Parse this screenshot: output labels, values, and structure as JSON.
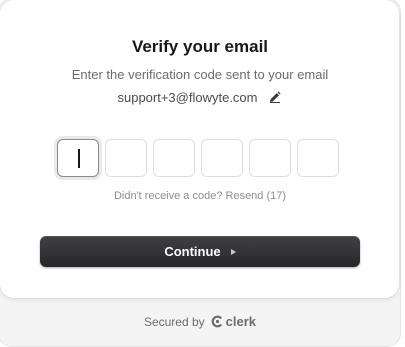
{
  "header": {
    "title": "Verify your email",
    "subtitle": "Enter the verification code sent to your email",
    "email": "support+3@flowyte.com",
    "edit_icon": "pencil-icon"
  },
  "otp": {
    "digits": [
      "",
      "",
      "",
      "",
      "",
      ""
    ],
    "active_index": 0
  },
  "resend": {
    "text": "Didn't receive a code? Resend (17)"
  },
  "actions": {
    "continue_label": "Continue",
    "continue_icon": "play-triangle-icon",
    "button_color": "#2f2f33"
  },
  "footer": {
    "secured_by": "Secured by",
    "brand": "clerk",
    "brand_icon": "clerk-logo-icon"
  }
}
